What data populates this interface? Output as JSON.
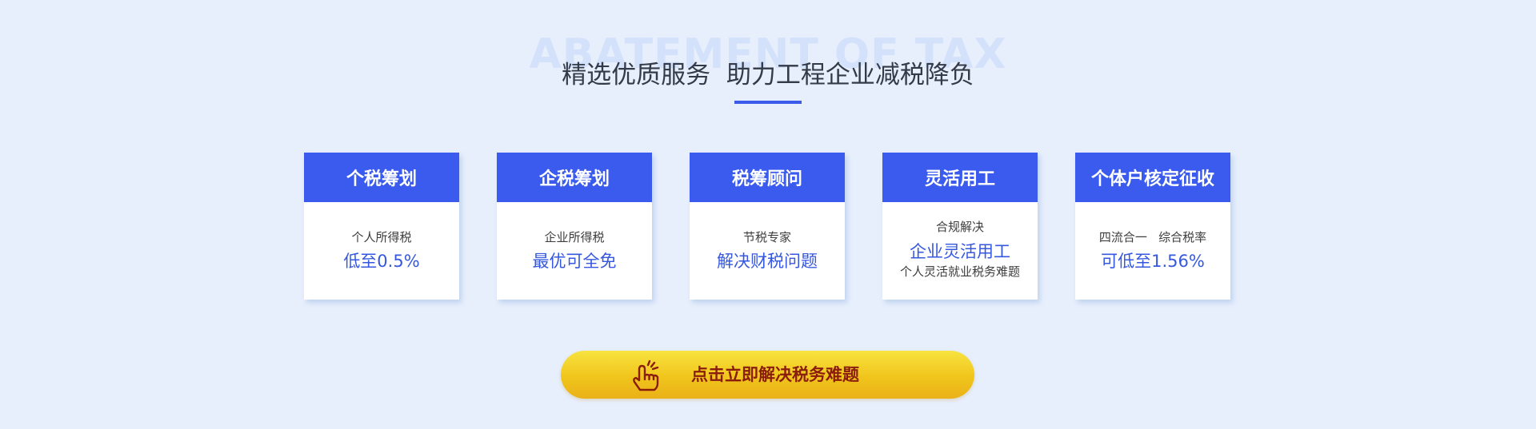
{
  "section": {
    "watermark": "ABATEMENT OF TAX",
    "headline": "精选优质服务  助力工程企业减税降负"
  },
  "cards": [
    {
      "title": "个税筹划",
      "subtitle": "个人所得税",
      "highlight": "低至0.5%"
    },
    {
      "title": "企税筹划",
      "subtitle": "企业所得税",
      "highlight": "最优可全免"
    },
    {
      "title": "税筹顾问",
      "subtitle": "节税专家",
      "highlight": "解决财税问题"
    },
    {
      "title": "灵活用工",
      "subtitle": "合规解决",
      "highlight": "企业灵活用工",
      "note": "个人灵活就业税务难题"
    },
    {
      "title": "个体户核定征收",
      "subtitle": "四流合一   综合税率",
      "highlight": "可低至1.56%"
    }
  ],
  "cta": {
    "label": "点击立即解决税务难题",
    "icon": "pointing-hand-icon"
  },
  "colors": {
    "background": "#e7effc",
    "accent": "#3a5bed",
    "highlight_text": "#3658e0",
    "cta_start": "#f8e33f",
    "cta_end": "#eab118",
    "cta_text": "#8a1d0c"
  }
}
